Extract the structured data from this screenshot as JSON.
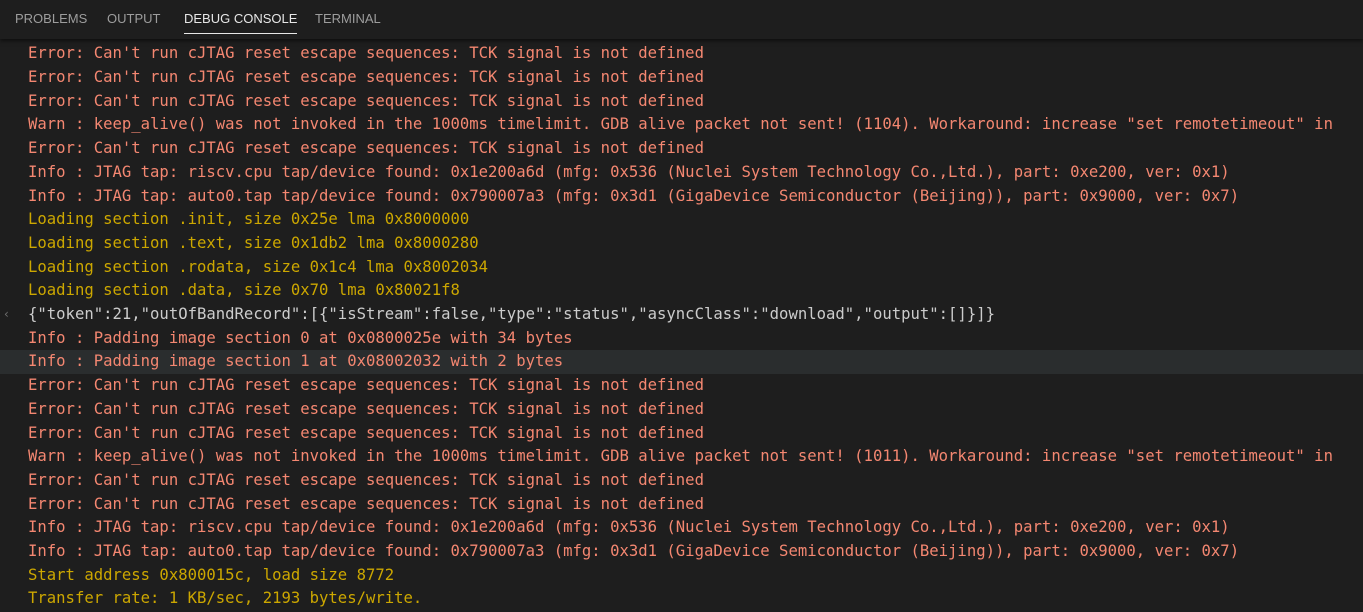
{
  "colors": {
    "background": "#1e1e1e",
    "error": "#f48771",
    "warn": "#f48771",
    "loading": "#cca700",
    "default": "#cccccc",
    "tab_inactive": "#9d9d9d",
    "tab_active": "#e7e7e7",
    "row_highlight": "#2a2d2e"
  },
  "tabs": [
    {
      "label": "PROBLEMS",
      "active": false
    },
    {
      "label": "OUTPUT",
      "active": false
    },
    {
      "label": "DEBUG CONSOLE",
      "active": true
    },
    {
      "label": "TERMINAL",
      "active": false
    }
  ],
  "console": {
    "lines": [
      {
        "text": "Error: Can't run cJTAG reset escape sequences: TCK signal is not defined",
        "kind": "error"
      },
      {
        "text": "Error: Can't run cJTAG reset escape sequences: TCK signal is not defined",
        "kind": "error"
      },
      {
        "text": "Error: Can't run cJTAG reset escape sequences: TCK signal is not defined",
        "kind": "error"
      },
      {
        "text": "Warn : keep_alive() was not invoked in the 1000ms timelimit. GDB alive packet not sent! (1104). Workaround: increase \"set remotetimeout\" in",
        "kind": "warn"
      },
      {
        "text": "Error: Can't run cJTAG reset escape sequences: TCK signal is not defined",
        "kind": "error"
      },
      {
        "text": "Info : JTAG tap: riscv.cpu tap/device found: 0x1e200a6d (mfg: 0x536 (Nuclei System Technology Co.,Ltd.), part: 0xe200, ver: 0x1)",
        "kind": "error"
      },
      {
        "text": "Info : JTAG tap: auto0.tap tap/device found: 0x790007a3 (mfg: 0x3d1 (GigaDevice Semiconductor (Beijing)), part: 0x9000, ver: 0x7)",
        "kind": "error"
      },
      {
        "text": "Loading section .init, size 0x25e lma 0x8000000",
        "kind": "loading"
      },
      {
        "text": "Loading section .text, size 0x1db2 lma 0x8000280",
        "kind": "loading"
      },
      {
        "text": "Loading section .rodata, size 0x1c4 lma 0x8002034",
        "kind": "loading"
      },
      {
        "text": "Loading section .data, size 0x70 lma 0x80021f8",
        "kind": "loading"
      },
      {
        "text": "{\"token\":21,\"outOfBandRecord\":[{\"isStream\":false,\"type\":\"status\",\"asyncClass\":\"download\",\"output\":[]}]}",
        "kind": "default",
        "gutter": "‹"
      },
      {
        "text": "Info : Padding image section 0 at 0x0800025e with 34 bytes",
        "kind": "error"
      },
      {
        "text": "Info : Padding image section 1 at 0x08002032 with 2 bytes",
        "kind": "error",
        "highlight": true
      },
      {
        "text": "Error: Can't run cJTAG reset escape sequences: TCK signal is not defined",
        "kind": "error"
      },
      {
        "text": "Error: Can't run cJTAG reset escape sequences: TCK signal is not defined",
        "kind": "error"
      },
      {
        "text": "Error: Can't run cJTAG reset escape sequences: TCK signal is not defined",
        "kind": "error"
      },
      {
        "text": "Warn : keep_alive() was not invoked in the 1000ms timelimit. GDB alive packet not sent! (1011). Workaround: increase \"set remotetimeout\" in",
        "kind": "warn"
      },
      {
        "text": "Error: Can't run cJTAG reset escape sequences: TCK signal is not defined",
        "kind": "error"
      },
      {
        "text": "Error: Can't run cJTAG reset escape sequences: TCK signal is not defined",
        "kind": "error"
      },
      {
        "text": "Info : JTAG tap: riscv.cpu tap/device found: 0x1e200a6d (mfg: 0x536 (Nuclei System Technology Co.,Ltd.), part: 0xe200, ver: 0x1)",
        "kind": "error"
      },
      {
        "text": "Info : JTAG tap: auto0.tap tap/device found: 0x790007a3 (mfg: 0x3d1 (GigaDevice Semiconductor (Beijing)), part: 0x9000, ver: 0x7)",
        "kind": "error"
      },
      {
        "text": "Start address 0x800015c, load size 8772",
        "kind": "loading"
      },
      {
        "text": "Transfer rate: 1 KB/sec, 2193 bytes/write.",
        "kind": "loading"
      }
    ]
  }
}
